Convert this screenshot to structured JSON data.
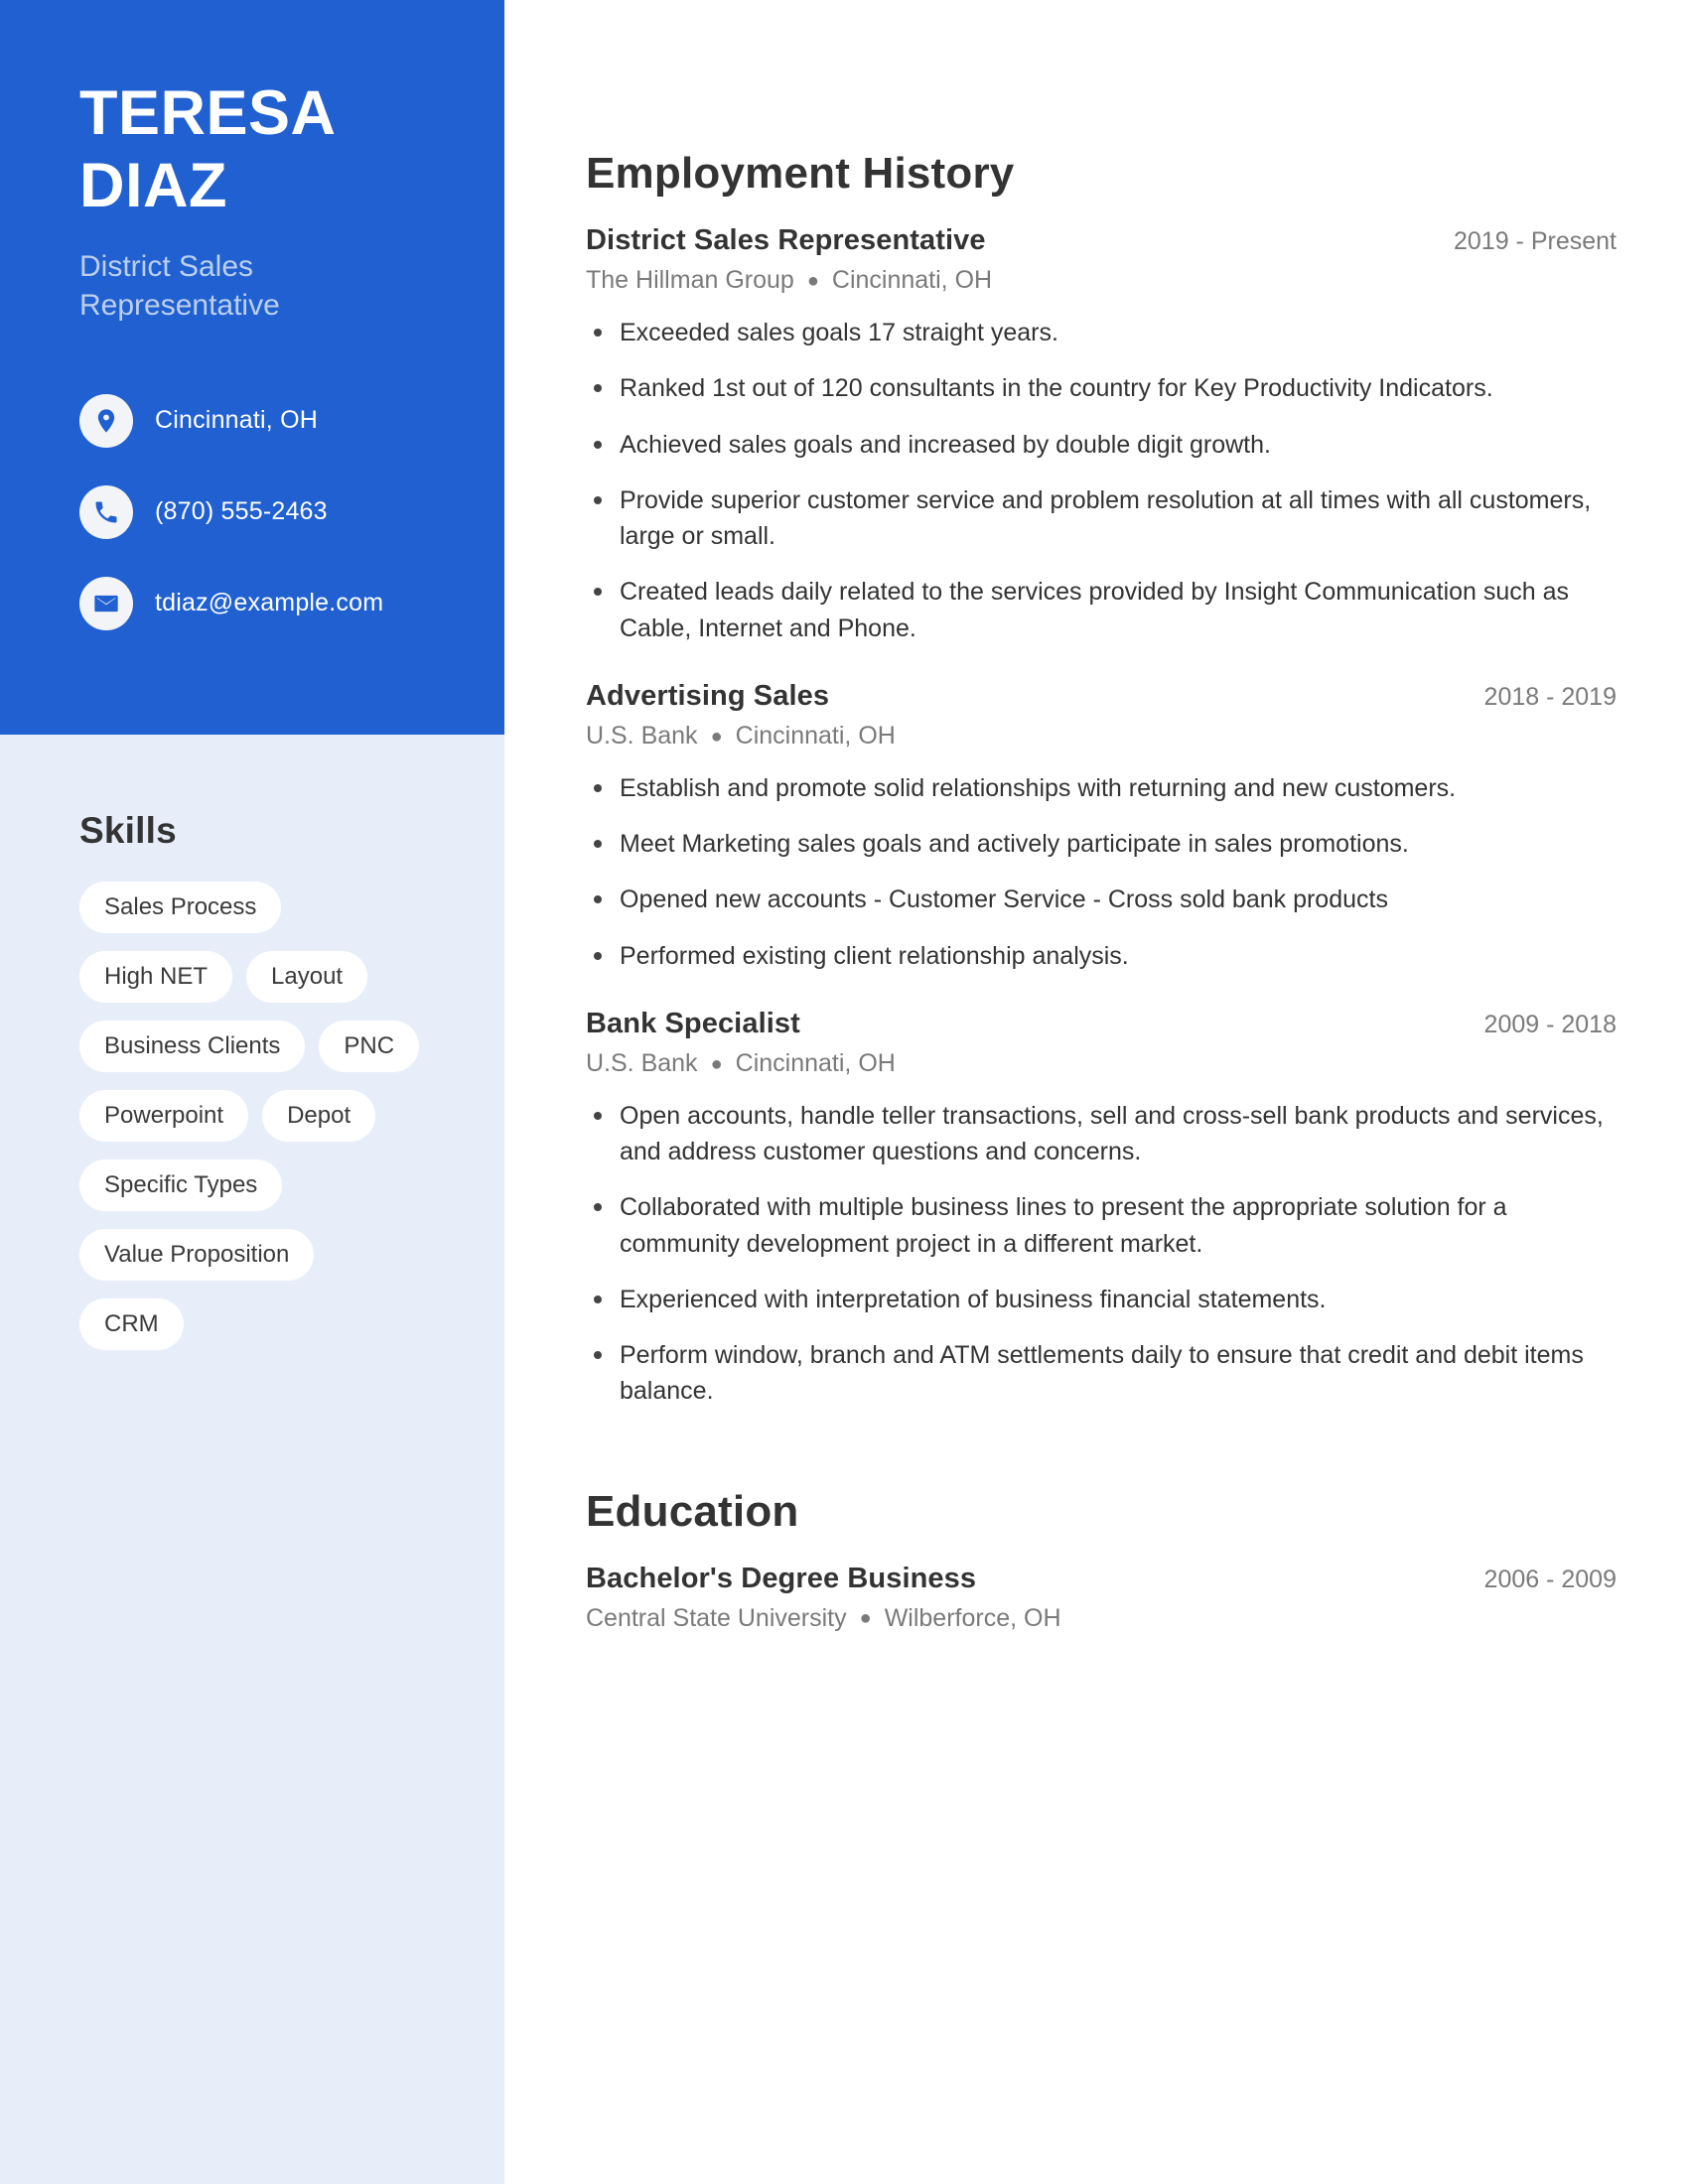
{
  "profile": {
    "first_name": "TERESA",
    "last_name": "DIAZ",
    "role": "District Sales Representative",
    "accent_color": "#2060d0",
    "sidebar_color": "#e8eef9"
  },
  "contacts": [
    {
      "icon": "location-pin-icon",
      "text": "Cincinnati, OH"
    },
    {
      "icon": "phone-icon",
      "text": "(870) 555-2463"
    },
    {
      "icon": "email-icon",
      "text": "tdiaz@example.com"
    }
  ],
  "skills": {
    "title": "Skills",
    "items": [
      "Sales Process",
      "High NET",
      "Layout",
      "Business Clients",
      "PNC",
      "Powerpoint",
      "Depot",
      "Specific Types",
      "Value Proposition",
      "CRM"
    ]
  },
  "employment": {
    "title": "Employment History",
    "entries": [
      {
        "job_title": "District Sales Representative",
        "date": "2019 - Present",
        "company": "The Hillman Group",
        "location": "Cincinnati, OH",
        "bullets": [
          "Exceeded sales goals 17 straight years.",
          "Ranked 1st out of 120 consultants in the country for Key Productivity Indicators.",
          "Achieved sales goals and increased by double digit growth.",
          "Provide superior customer service and problem resolution at all times with all customers, large or small.",
          "Created leads daily related to the services provided by Insight Communication such as Cable, Internet and Phone."
        ]
      },
      {
        "job_title": "Advertising Sales",
        "date": "2018 - 2019",
        "company": "U.S. Bank",
        "location": "Cincinnati, OH",
        "bullets": [
          "Establish and promote solid relationships with returning and new customers.",
          "Meet Marketing sales goals and actively participate in sales promotions.",
          "Opened new accounts - Customer Service - Cross sold bank products",
          "Performed existing client relationship analysis."
        ]
      },
      {
        "job_title": "Bank Specialist",
        "date": "2009 - 2018",
        "company": "U.S. Bank",
        "location": "Cincinnati, OH",
        "bullets": [
          "Open accounts, handle teller transactions, sell and cross-sell bank products and services, and address customer questions and concerns.",
          "Collaborated with multiple business lines to present the appropriate solution for a community development project in a different market.",
          "Experienced with interpretation of business financial statements.",
          "Perform window, branch and ATM settlements daily to ensure that credit and debit items balance."
        ]
      }
    ]
  },
  "education": {
    "title": "Education",
    "entries": [
      {
        "degree": "Bachelor's Degree Business",
        "date": "2006 - 2009",
        "school": "Central State University",
        "location": "Wilberforce, OH"
      }
    ]
  }
}
